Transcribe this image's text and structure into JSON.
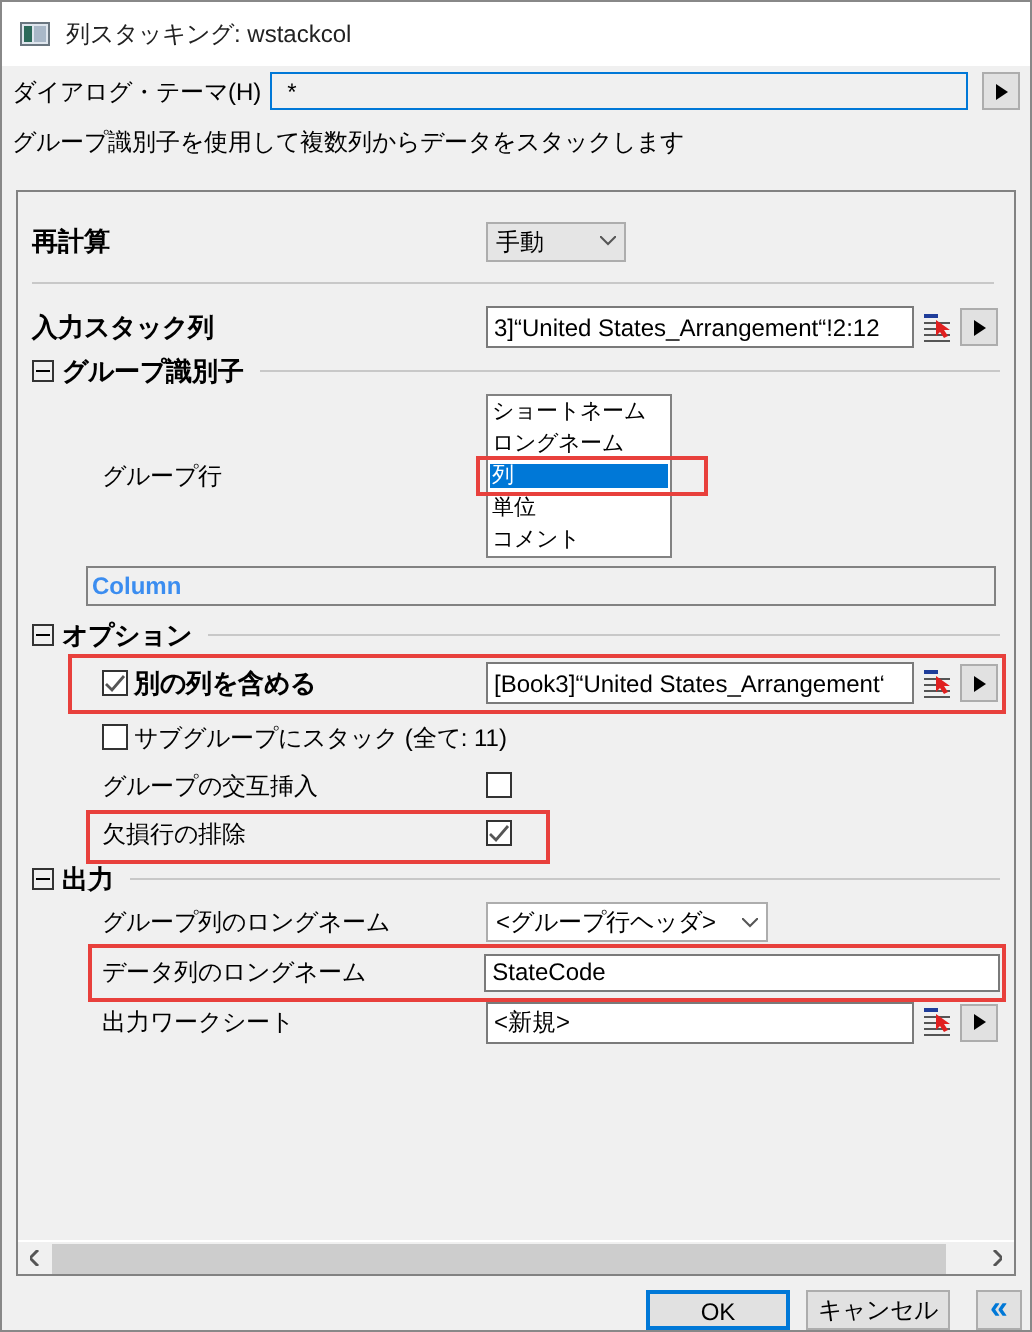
{
  "window": {
    "title": "列スタッキング: wstackcol"
  },
  "theme": {
    "label": "ダイアログ・テーマ(H)",
    "value": "*"
  },
  "description": "グループ識別子を使用して複数列からデータをスタックします",
  "recalculate": {
    "label": "再計算",
    "value": "手動"
  },
  "input": {
    "label": "入力スタック列",
    "value": "3]“United States_Arrangement“!2:12"
  },
  "group_identifier": {
    "title": "グループ識別子",
    "expanded": true,
    "group_row_label": "グループ行",
    "list": [
      {
        "label": "ショートネーム",
        "selected": false
      },
      {
        "label": "ロングネーム",
        "selected": false
      },
      {
        "label": "列",
        "selected": true,
        "highlighted": true
      },
      {
        "label": "単位",
        "selected": false
      },
      {
        "label": "コメント",
        "selected": false
      }
    ],
    "preview": "Column"
  },
  "options": {
    "title": "オプション",
    "expanded": true,
    "rows": [
      {
        "kind": "checkbox_field",
        "label": "別の列を含める",
        "checked": true,
        "value": "[Book3]“United States_Arrangement‘",
        "highlighted": true
      },
      {
        "kind": "checkbox",
        "label": "サブグループにスタック (全て: 11)",
        "checked": false,
        "highlighted": false
      },
      {
        "kind": "label_checkbox",
        "label": "グループの交互挿入",
        "checked": false,
        "highlighted": false
      },
      {
        "kind": "label_checkbox",
        "label": "欠損行の排除",
        "checked": true,
        "highlighted": true
      }
    ]
  },
  "output": {
    "title": "出力",
    "expanded": true,
    "rows": [
      {
        "kind": "dropdown",
        "label": "グループ列のロングネーム",
        "value": "<グループ行ヘッダ>",
        "highlighted": false
      },
      {
        "kind": "text",
        "label": "データ列のロングネーム",
        "value": "StateCode",
        "highlighted": true
      },
      {
        "kind": "picker",
        "label": "出力ワークシート",
        "value": "<新規>",
        "highlighted": false
      }
    ]
  },
  "buttons": {
    "ok": "OK",
    "cancel": "キャンセル",
    "collapse": "«"
  }
}
